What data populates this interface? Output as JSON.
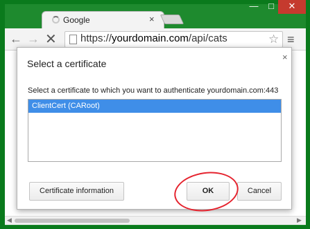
{
  "window": {
    "minimize_glyph": "—",
    "maximize_glyph": "□",
    "close_glyph": "✕"
  },
  "tab": {
    "title": "Google",
    "close_glyph": "×"
  },
  "toolbar": {
    "back_glyph": "←",
    "forward_glyph": "→",
    "stop_glyph": "✕",
    "url_scheme": "https://",
    "url_host": "yourdomain.com",
    "url_path": "/api/cats",
    "star_glyph": "☆",
    "menu_glyph": "≡"
  },
  "dialog": {
    "title": "Select a certificate",
    "close_glyph": "×",
    "description": "Select a certificate to which you want to authenticate yourdomain.com:443",
    "certificates": [
      "ClientCert (CARoot)"
    ],
    "buttons": {
      "info": "Certificate information",
      "ok": "OK",
      "cancel": "Cancel"
    }
  },
  "scrollbar": {
    "left_glyph": "◀",
    "right_glyph": "▶"
  },
  "colors": {
    "desktop": "#0a7a1c",
    "selection": "#3f8ee8",
    "annotation": "#e5232e"
  }
}
